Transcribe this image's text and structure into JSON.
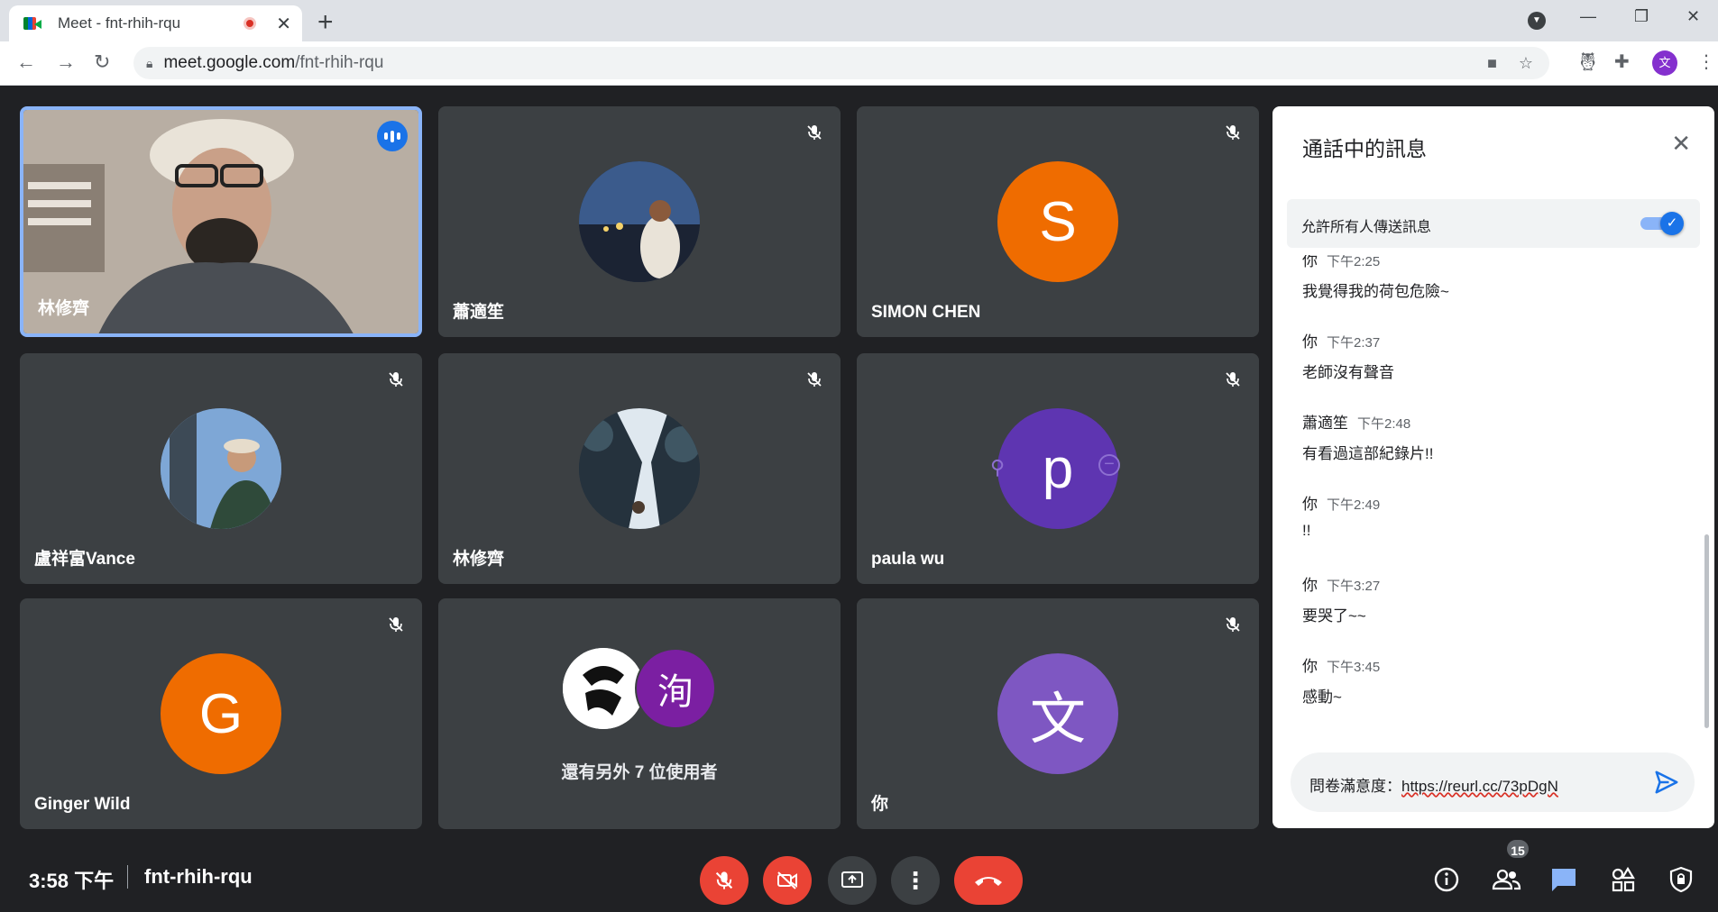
{
  "browser": {
    "tab_title": "Meet - fnt-rhih-rqu",
    "url_host": "meet.google.com",
    "url_path": "/fnt-rhih-rqu",
    "profile_initial": "文"
  },
  "participants": [
    {
      "name": "林修齊",
      "speaking": true
    },
    {
      "name": "蕭適笙",
      "muted": true
    },
    {
      "name": "SIMON CHEN",
      "initial": "S",
      "color": "#ef6c00",
      "muted": true
    },
    {
      "name": "盧祥富Vance",
      "muted": true
    },
    {
      "name": "林修齊",
      "muted": true
    },
    {
      "name": "paula wu",
      "initial": "p",
      "color": "#5e35b1",
      "muted": true
    },
    {
      "name": "Ginger Wild",
      "initial": "G",
      "color": "#ef6c00",
      "muted": true
    },
    {
      "others_text": "還有另外 7 位使用者",
      "initial": "洵",
      "color": "#7b1fa2"
    },
    {
      "name": "你",
      "initial": "文",
      "color": "#7e57c2",
      "muted": true
    }
  ],
  "chat": {
    "title": "通話中的訊息",
    "allow_label": "允許所有人傳送訊息",
    "messages": [
      {
        "sender": "你",
        "time": "下午2:25",
        "text": "我覺得我的荷包危險~"
      },
      {
        "sender": "你",
        "time": "下午2:37",
        "text": "老師沒有聲音"
      },
      {
        "sender": "蕭適笙",
        "time": "下午2:48",
        "text": "有看過這部紀錄片!!"
      },
      {
        "sender": "你",
        "time": "下午2:49",
        "text": "!!"
      },
      {
        "sender": "你",
        "time": "下午3:27",
        "text": "要哭了~~"
      },
      {
        "sender": "你",
        "time": "下午3:45",
        "text": "感動~"
      }
    ],
    "compose_prefix": "問卷滿意度：",
    "compose_link": "https://reurl.cc/73pDgN"
  },
  "bottom_bar": {
    "time": "3:58 下午",
    "meeting_code": "fnt-rhih-rqu",
    "participant_count": "15"
  },
  "colors": {
    "accent": "#1a73e8",
    "danger": "#ea4335",
    "tile_bg": "#3c4043",
    "stage_bg": "#202124"
  }
}
